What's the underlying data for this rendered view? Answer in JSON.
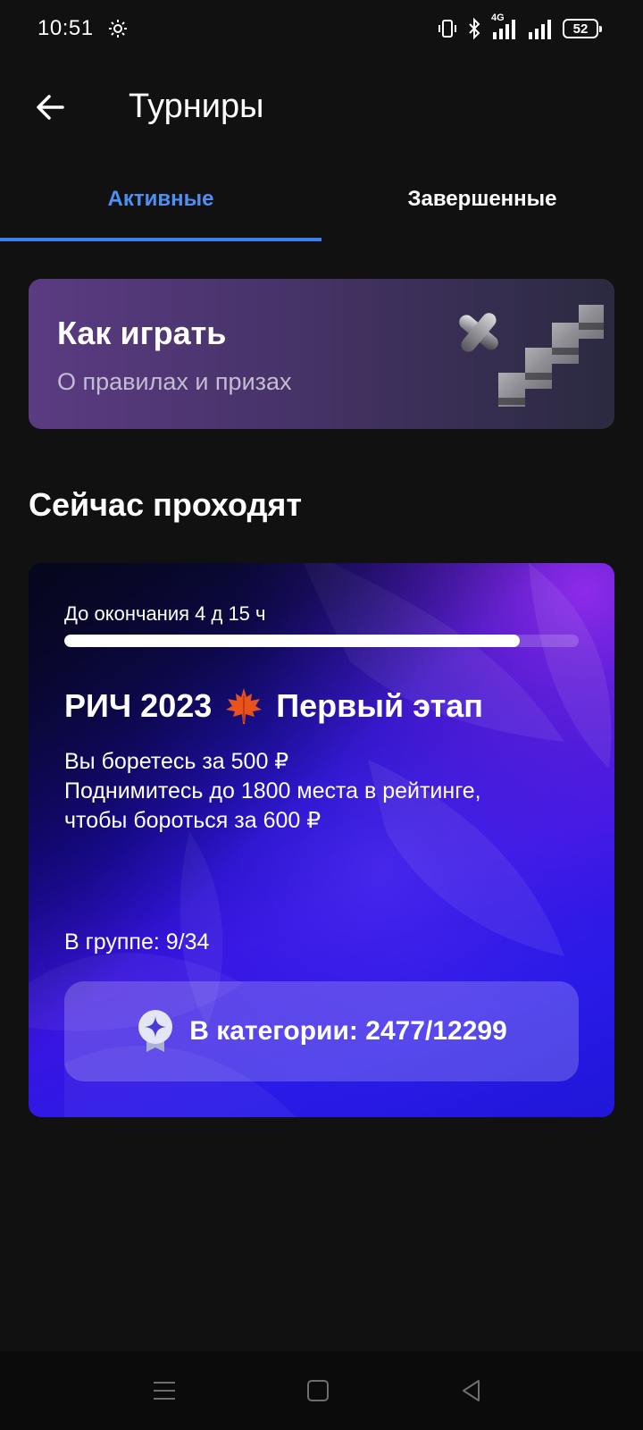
{
  "status_bar": {
    "time": "10:51",
    "network": "4G",
    "battery": "52",
    "icons": [
      "settings-gear-icon",
      "vibrate-icon",
      "bluetooth-icon",
      "signal-4g-icon",
      "signal-icon",
      "battery-icon"
    ]
  },
  "header": {
    "title": "Турниры",
    "back_icon": "arrow-left-icon"
  },
  "tabs": [
    {
      "label": "Активные",
      "active": true
    },
    {
      "label": "Завершенные",
      "active": false
    }
  ],
  "colors": {
    "accent": "#3b7ff0",
    "background": "#111112",
    "howto_card": "#4b346e",
    "tournament_card": "#2a1ae8"
  },
  "howto_card": {
    "title": "Как играть",
    "subtitle": "О правилах и призах"
  },
  "section": {
    "title": "Сейчас проходят"
  },
  "tournament": {
    "remaining_label": "До окончания 4 д 15 ч",
    "progress": 0.885,
    "title": "РИЧ 2023",
    "title_suffix": "Первый этап",
    "title_icon": "maple-leaf-icon",
    "description": [
      "Вы боретесь за 500 ₽",
      "Поднимитесь до 1800 места в рейтинге,",
      "чтобы бороться за 600 ₽"
    ],
    "group_label": "В группе: 9/34",
    "category_label": "В категории: 2477/12299",
    "category_icon": "award-badge-icon"
  },
  "navbar": {
    "icons": [
      "menu-icon",
      "home-square-icon",
      "back-triangle-icon"
    ]
  }
}
